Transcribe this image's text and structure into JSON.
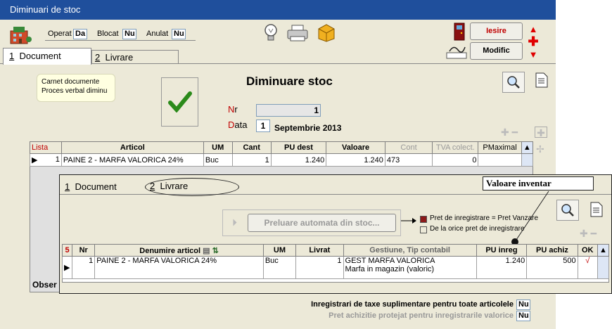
{
  "window": {
    "title": "Diminuari de stoc"
  },
  "toolbar": {
    "operat_label": "Operat",
    "operat_value": "Da",
    "blocat_label": "Blocat",
    "blocat_value": "Nu",
    "anulat_label": "Anulat",
    "anulat_value": "Nu",
    "iesire_label": "Iesire",
    "modific_label": "Modific"
  },
  "tabs": [
    {
      "num": "1",
      "label": "Document"
    },
    {
      "num": "2",
      "label": "Livrare"
    }
  ],
  "carnet": {
    "line1": "Carnet documente",
    "line2": "Proces verbal diminu"
  },
  "doc": {
    "title": "Diminuare stoc",
    "nr_label": "Nr",
    "nr_value": "1",
    "data_label": "Data",
    "data_day": "1",
    "data_rest": "Septembrie 2013"
  },
  "main_table": {
    "headers": [
      "Lista",
      "Articol",
      "UM",
      "Cant",
      "PU dest",
      "Valoare",
      "Cont",
      "TVA colect.",
      "PMaximal"
    ],
    "row": {
      "lista": "1",
      "articol": "PAINE 2 - MARFA VALORICA 24%",
      "um": "Buc",
      "cant": "1",
      "pu_dest": "1.240",
      "valoare": "1.240",
      "cont": "473",
      "tva": "0",
      "pmax": ""
    }
  },
  "obs_label": "Obser",
  "overlay": {
    "tabs": [
      {
        "num": "1",
        "label": "Document"
      },
      {
        "num": "2",
        "label": "Livrare"
      }
    ],
    "callout": "Valoare inventar",
    "preluare_button": "Preluare automata din stoc...",
    "option1": "Pret de inregistrare = Pret Vanzare",
    "option2": "De la orice pret de inregistrare",
    "count": "5",
    "headers": [
      "Nr",
      "Denumire articol",
      "UM",
      "Livrat",
      "Gestiune, Tip contabil",
      "PU inreg",
      "PU achiz",
      "OK"
    ],
    "row": {
      "nr": "1",
      "denumire": "PAINE 2 - MARFA VALORICA 24%",
      "um": "Buc",
      "livrat": "1",
      "gestiune": "GEST MARFA VALORICA",
      "tip": "Marfa in magazin (valoric)",
      "pu_inreg": "1.240",
      "pu_achiz": "500",
      "ok": "√"
    }
  },
  "footer": {
    "line1": "Inregistrari de taxe suplimentare pentru toate articolele",
    "line1_value": "Nu",
    "line2": "Pret achizitie protejat pentru inregistrarile valorice",
    "line2_value": "Nu"
  },
  "colors": {
    "title_bar": "#1f4f9c",
    "window": "#ece9d8",
    "accent_red": "#c00000",
    "note": "#ffffe1"
  }
}
